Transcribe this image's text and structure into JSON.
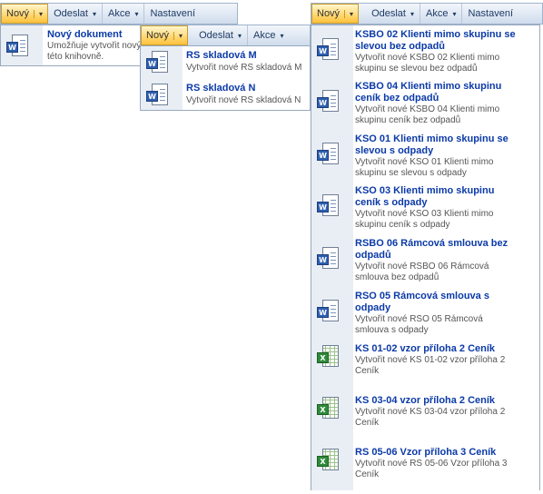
{
  "toolbar1": {
    "new_label": "Nový",
    "send_label": "Odeslat",
    "actions_label": "Akce",
    "settings_label": "Nastavení"
  },
  "menu1": {
    "title": "Nový dokument",
    "desc1": "Umožňuje vytvořit nový dokument v",
    "desc2": "této knihovně."
  },
  "toolbar2": {
    "new_label": "Nový",
    "send_label": "Odeslat",
    "actions_label": "Akce"
  },
  "menu2": {
    "items": [
      {
        "title": "RS skladová M",
        "desc": "Vytvořit nové RS skladová M"
      },
      {
        "title": "RS skladová N",
        "desc": "Vytvořit nové RS skladová N"
      }
    ]
  },
  "toolbar3": {
    "new_label": "Nový",
    "send_label": "Odeslat",
    "actions_label": "Akce",
    "settings_label": "Nastavení"
  },
  "menu3": {
    "items": [
      {
        "icon": "word-document-icon",
        "t1": "KSBO 02 Klienti mimo skupinu se",
        "t2": "slevou bez odpadů",
        "d1": "Vytvořit nové KSBO 02 Klienti mimo",
        "d2": "skupinu se slevou bez odpadů"
      },
      {
        "icon": "word-document-icon",
        "t1": "KSBO 04 Klienti mimo skupinu",
        "t2": "ceník bez odpadů",
        "d1": "Vytvořit nové KSBO 04 Klienti mimo",
        "d2": "skupinu ceník bez odpadů"
      },
      {
        "icon": "word-document-icon",
        "t1": "KSO 01 Klienti mimo skupinu se",
        "t2": "slevou s odpady",
        "d1": "Vytvořit nové KSO 01 Klienti mimo",
        "d2": "skupinu se slevou s odpady"
      },
      {
        "icon": "word-document-icon",
        "t1": "KSO 03 Klienti mimo skupinu",
        "t2": "ceník s odpady",
        "d1": "Vytvořit nové KSO 03 Klienti mimo",
        "d2": "skupinu ceník s odpady"
      },
      {
        "icon": "word-document-icon",
        "t1": "RSBO 06 Rámcová smlouva bez",
        "t2": "odpadů",
        "d1": "Vytvořit nové RSBO 06 Rámcová",
        "d2": "smlouva bez odpadů"
      },
      {
        "icon": "word-document-icon",
        "t1": "RSO 05 Rámcová smlouva s",
        "t2": "odpady",
        "d1": "Vytvořit nové RSO 05 Rámcová",
        "d2": "smlouva s odpady"
      },
      {
        "icon": "excel-document-icon",
        "t1": "KS 01-02 vzor příloha 2 Ceník",
        "t2": "",
        "d1": "Vytvořit nové KS 01-02 vzor příloha 2",
        "d2": "Ceník"
      },
      {
        "icon": "excel-document-icon",
        "t1": "KS 03-04 vzor příloha 2 Ceník",
        "t2": "",
        "d1": "Vytvořit nové KS 03-04 vzor příloha 2",
        "d2": "Ceník"
      },
      {
        "icon": "excel-document-icon",
        "t1": "RS 05-06 Vzor příloha 3 Ceník",
        "t2": "",
        "d1": "Vytvořit nové RS 05-06 Vzor příloha 3",
        "d2": "Ceník"
      }
    ]
  }
}
